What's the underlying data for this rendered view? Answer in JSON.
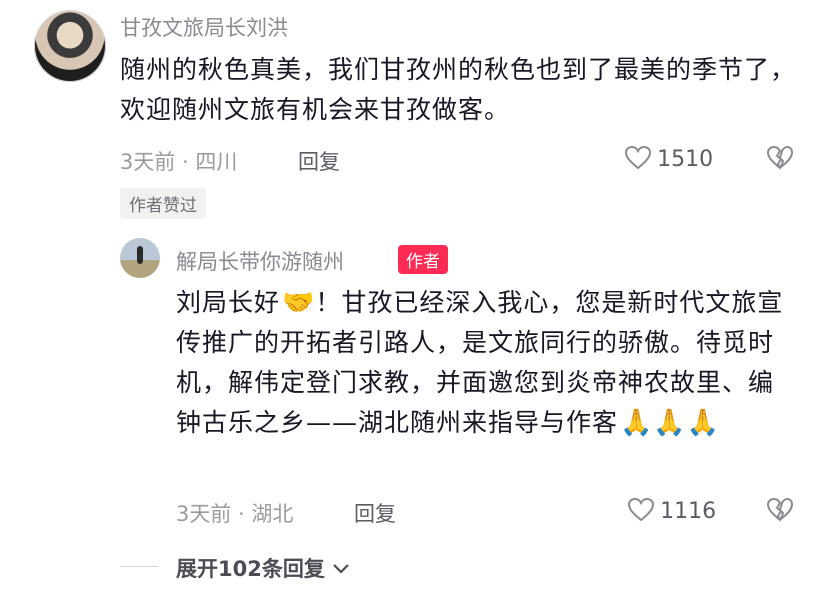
{
  "comment": {
    "author": "甘孜文旅局长刘洪",
    "text": "随州的秋色真美，我们甘孜州的秋色也到了最美的季节了，欢迎随州文旅有机会来甘孜做客。",
    "time_location": "3天前 · 四川",
    "reply_label": "回复",
    "likes": "1510",
    "author_liked_badge": "作者赞过"
  },
  "reply": {
    "author": "解局长带你游随州",
    "author_badge": "作者",
    "text": "刘局长好",
    "text_rest": "！甘孜已经深入我心，您是新时代文旅宣传推广的开拓者引路人，是文旅同行的骄傲。待觅时机，解伟定登门求教，并面邀您到炎帝神农故里、编钟古乐之乡——湖北随州来指导与作客",
    "time_location": "3天前 · 湖北",
    "reply_label": "回复",
    "likes": "1116"
  },
  "expand": {
    "label": "展开102条回复"
  },
  "icons": {
    "heart": "heart-outline-icon",
    "dislike": "broken-heart-icon",
    "chevron": "chevron-down-icon",
    "handshake": "handshake-emoji",
    "pray": "folded-hands-emoji"
  },
  "colors": {
    "accent": "#fe2c55"
  }
}
